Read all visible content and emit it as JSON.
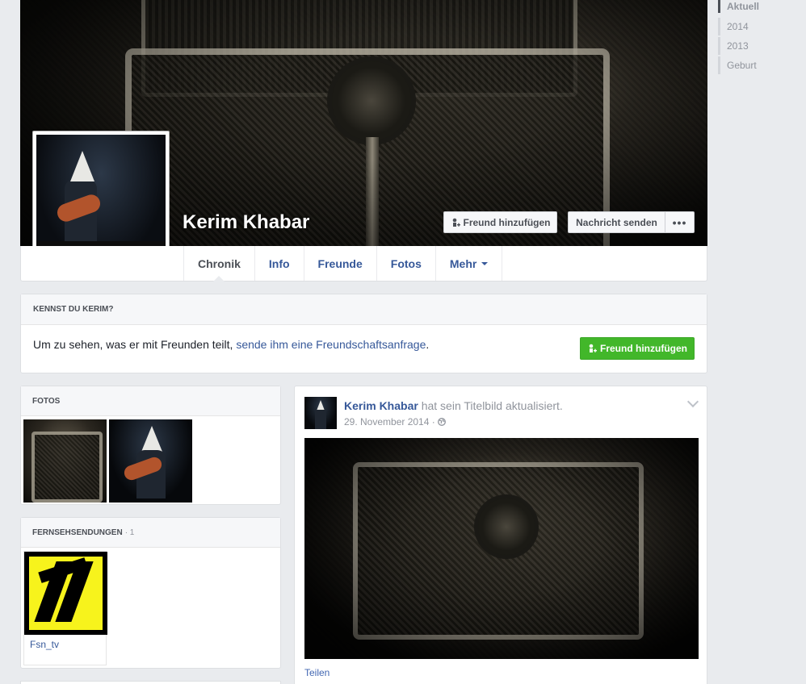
{
  "profile": {
    "name": "Kerim Khabar"
  },
  "cover_buttons": {
    "add_friend": "Freund hinzufügen",
    "send_message": "Nachricht senden",
    "more": "•••"
  },
  "tabs": [
    {
      "label": "Chronik",
      "active": true
    },
    {
      "label": "Info"
    },
    {
      "label": "Freunde"
    },
    {
      "label": "Fotos"
    },
    {
      "label": "Mehr"
    }
  ],
  "timeline_nav": [
    {
      "label": "Aktuell",
      "active": true
    },
    {
      "label": "2014"
    },
    {
      "label": "2013"
    },
    {
      "label": "Geburt"
    }
  ],
  "know_box": {
    "heading": "KENNST DU KERIM?",
    "text": "Um zu sehen, was er mit Freunden teilt, ",
    "link": "sende ihm eine Freundschaftsanfrage",
    "end": ".",
    "button": "Freund hinzufügen"
  },
  "fotos_box": {
    "heading": "FOTOS"
  },
  "tv_box": {
    "heading": "FERNSEHSENDUNGEN",
    "count": "· 1",
    "items": [
      {
        "label": "Fsn_tv"
      }
    ]
  },
  "post": {
    "author": "Kerim Khabar",
    "action": " hat sein Titelbild aktualisiert.",
    "date": "29. November 2014",
    "separator": " · ",
    "privacy_icon": "globe-icon",
    "share": "Teilen"
  },
  "colors": {
    "link": "#365899",
    "green_button": "#42b72a",
    "background": "#e9ebee"
  }
}
